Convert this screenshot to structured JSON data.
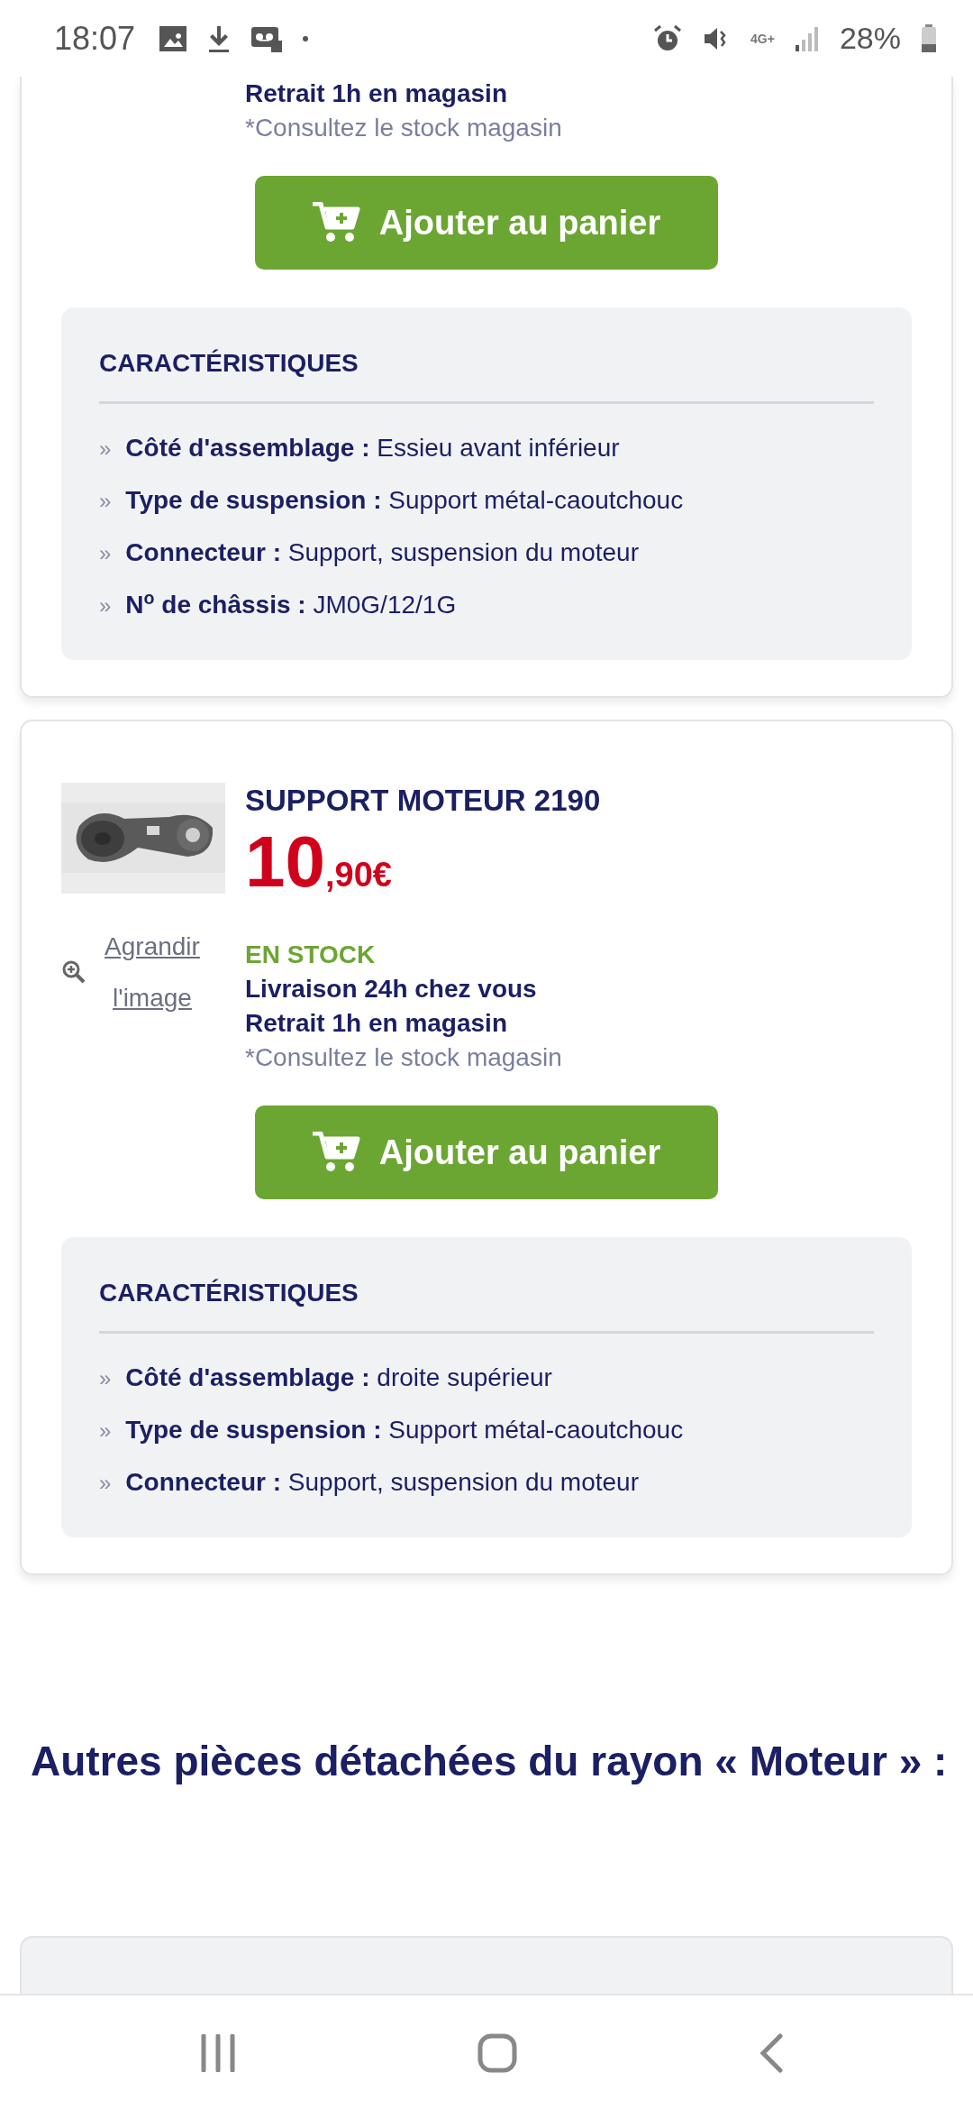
{
  "status_bar": {
    "time": "18:07",
    "network": "4G+",
    "battery": "28%"
  },
  "products": [
    {
      "lines": [
        "Retrait 1h en magasin"
      ],
      "note": "*Consultez le stock magasin",
      "button": "Ajouter au panier",
      "characteristics": {
        "title": "CARACTÉRISTIQUES",
        "items": [
          {
            "marker": "»",
            "label": "Côté d'assemblage :",
            "value": "Essieu avant inférieur"
          },
          {
            "marker": "»",
            "label": "Type de suspension :",
            "value": "Support métal-caoutchouc"
          },
          {
            "marker": "»",
            "label": "Connecteur :",
            "value": "Support, suspension du moteur"
          },
          {
            "marker": "»",
            "label": "N$^{o}$ de châssis :",
            "value": "JM0G/12/1G"
          }
        ]
      }
    },
    {
      "title": "SUPPORT MOTEUR 2190",
      "price_units": "10",
      "price_cents": ",90€",
      "image": {
        "kind": "picture"
      },
      "zoom_link": "Agrandir l'image",
      "stock": "EN STOCK",
      "lines": [
        "Livraison 24h chez vous",
        "Retrait 1h en magasin"
      ],
      "note": "*Consultez le stock magasin",
      "button": "Ajouter au panier",
      "characteristics": {
        "title": "CARACTÉRISTIQUES",
        "items": [
          {
            "marker": "»",
            "label": "Côté d'assemblage :",
            "value": "droite supérieur"
          },
          {
            "marker": "»",
            "label": "Type de suspension :",
            "value": "Support métal-caoutchouc"
          },
          {
            "marker": "»",
            "label": "Connecteur :",
            "value": "Support, suspension du moteur"
          }
        ]
      }
    }
  ],
  "section_heading": "Autres pièces détachées du rayon « Moteur » :"
}
